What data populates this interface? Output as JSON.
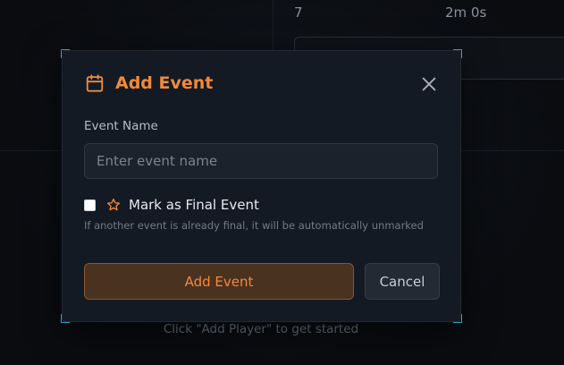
{
  "background": {
    "table_value_count": "7",
    "table_value_time": "2m 0s",
    "empty_hint": "Click \"Add Player\" to get started"
  },
  "dialog": {
    "title": "Add Event",
    "title_icon": "calendar-icon",
    "close_icon": "close-icon",
    "event_name_label": "Event Name",
    "event_name_placeholder": "Enter event name",
    "event_name_value": "",
    "final_checkbox_checked": false,
    "final_checkbox_icon": "star-icon",
    "final_checkbox_label": "Mark as Final Event",
    "final_hint": "If another event is already final, it will be automatically unmarked",
    "submit_label": "Add Event",
    "cancel_label": "Cancel"
  },
  "colors": {
    "accent": "#f08a3c",
    "focus_corner": "#29a0c8",
    "dialog_bg": "#141a23"
  }
}
